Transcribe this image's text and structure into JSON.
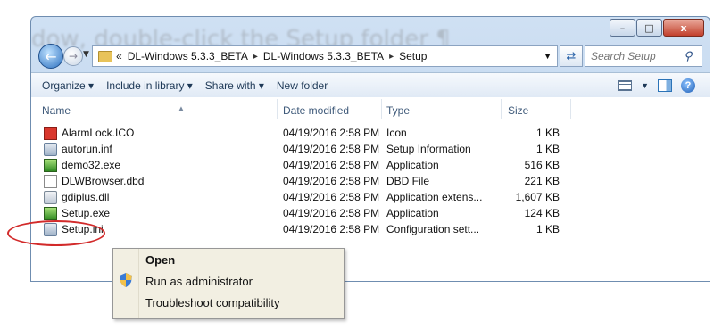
{
  "background_title": "dow, double-click the Setup folder ¶",
  "caption_buttons": {
    "minimize": "–",
    "maximize": "□",
    "close": "x"
  },
  "address_bar": {
    "prefix": "«",
    "segments": [
      "DL-Windows 5.3.3_BETA",
      "DL-Windows 5.3.3_BETA",
      "Setup"
    ],
    "separator": "▸"
  },
  "search": {
    "placeholder": "Search Setup"
  },
  "command_bar": {
    "organize": "Organize ▾",
    "include_in_library": "Include in library ▾",
    "share_with": "Share with ▾",
    "new_folder": "New folder"
  },
  "columns": {
    "name": "Name",
    "date_modified": "Date modified",
    "type": "Type",
    "size": "Size"
  },
  "files": [
    {
      "name": "AlarmLock.ICO",
      "date": "04/19/2016 2:58 PM",
      "type": "Icon",
      "size": "1 KB",
      "icon": "ico-file-icon"
    },
    {
      "name": "autorun.inf",
      "date": "04/19/2016 2:58 PM",
      "type": "Setup Information",
      "size": "1 KB",
      "icon": "inf-file-icon"
    },
    {
      "name": "demo32.exe",
      "date": "04/19/2016 2:58 PM",
      "type": "Application",
      "size": "516 KB",
      "icon": "exe-file-icon"
    },
    {
      "name": "DLWBrowser.dbd",
      "date": "04/19/2016 2:58 PM",
      "type": "DBD File",
      "size": "221 KB",
      "icon": "blank-file-icon"
    },
    {
      "name": "gdiplus.dll",
      "date": "04/19/2016 2:58 PM",
      "type": "Application extens...",
      "size": "1,607 KB",
      "icon": "dll-file-icon"
    },
    {
      "name": "Setup.exe",
      "date": "04/19/2016 2:58 PM",
      "type": "Application",
      "size": "124 KB",
      "icon": "exe-file-icon"
    },
    {
      "name": "Setup.ini",
      "date": "04/19/2016 2:58 PM",
      "type": "Configuration sett...",
      "size": "1 KB",
      "icon": "ini-file-icon"
    }
  ],
  "context_menu": {
    "open": "Open",
    "run_as_admin": "Run as administrator",
    "troubleshoot": "Troubleshoot compatibility"
  },
  "colors": {
    "highlight_ring": "#d22a2a",
    "menu_bg": "#f2efe2",
    "cmd_text": "#1e3957"
  }
}
